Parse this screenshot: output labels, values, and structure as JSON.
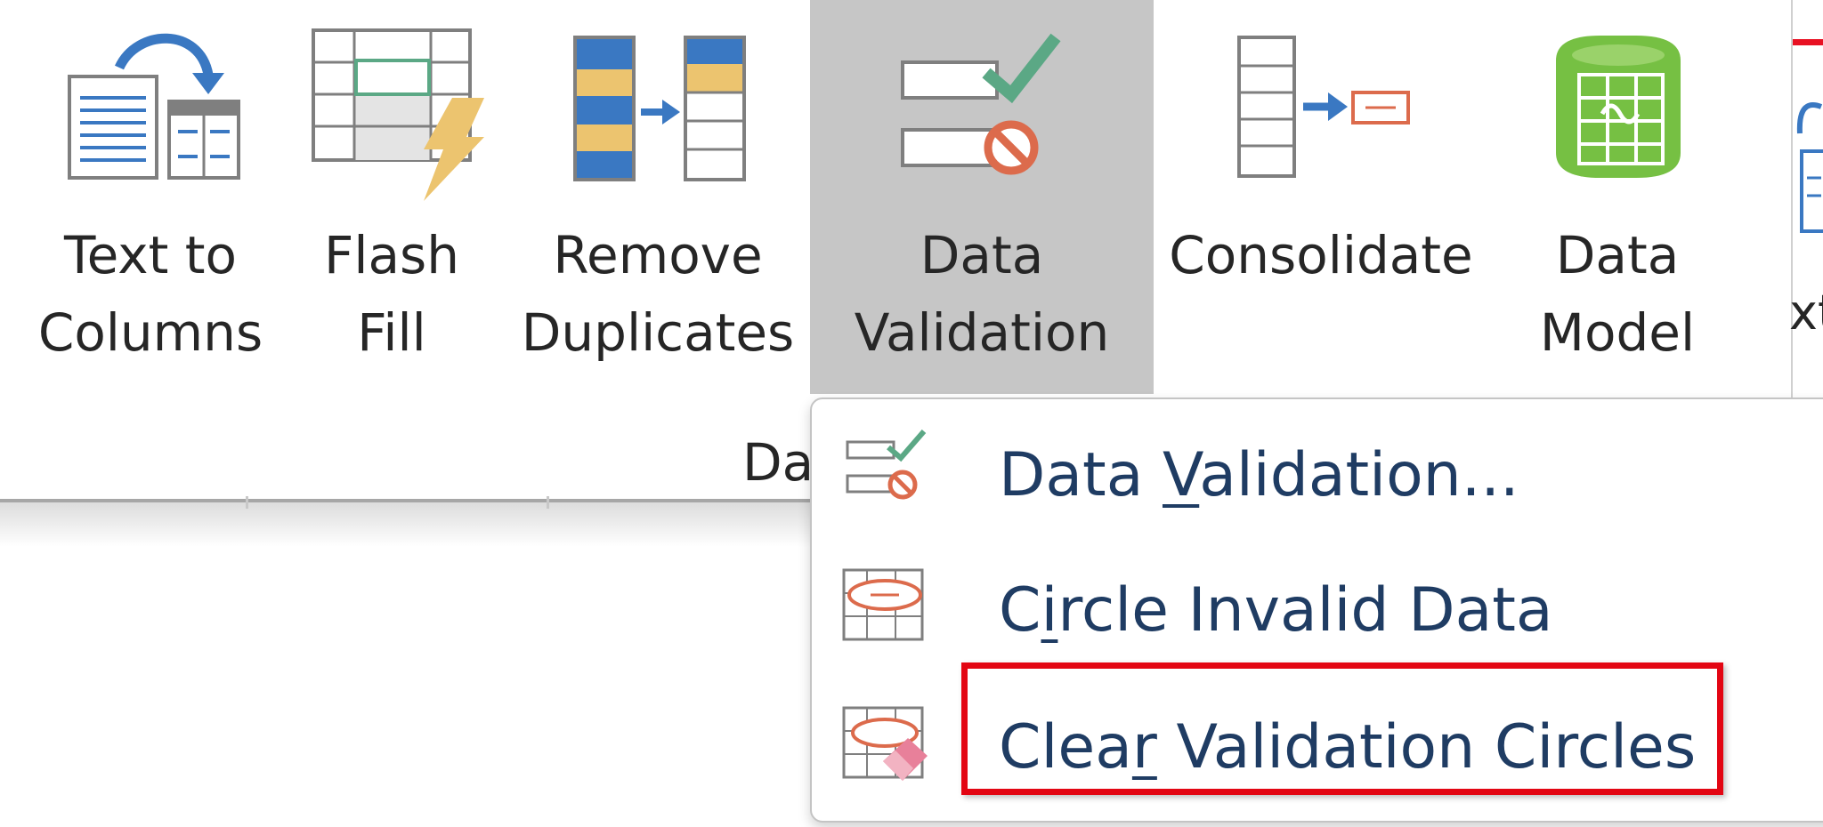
{
  "ribbon": {
    "buttons": [
      {
        "line1": "Text to",
        "line2": "Columns"
      },
      {
        "line1": "Flash",
        "line2": "Fill"
      },
      {
        "line1": "Remove",
        "line2": "Duplicates"
      },
      {
        "line1": "Data",
        "line2": "Validation",
        "has_dropdown": true,
        "active": true
      },
      {
        "line1": "Consolidate",
        "line2": ""
      },
      {
        "line1": "Data",
        "line2": "Model",
        "has_dropdown": true
      }
    ],
    "group_label_visible": "Da",
    "edge_text_visible": "xt"
  },
  "menu": {
    "items": [
      {
        "pre": "Data ",
        "key": "V",
        "post": "alidation..."
      },
      {
        "pre": "C",
        "key": "i",
        "post": "rcle Invalid Data"
      },
      {
        "pre": "Clea",
        "key": "r",
        "post": " Validation Circles",
        "highlighted": true
      }
    ]
  },
  "colors": {
    "active_button_bg": "#c6c6c6",
    "menu_text": "#1f3c63",
    "highlight_border": "#e30613",
    "icon_blue": "#3a78c2",
    "icon_gold": "#ecc46f",
    "icon_green": "#5ba885",
    "icon_red": "#dc6b4c",
    "icon_model_green": "#76c043"
  },
  "icons": [
    "text-to-columns-icon",
    "flash-fill-icon",
    "remove-duplicates-icon",
    "data-validation-icon",
    "consolidate-icon",
    "data-model-icon",
    "circle-invalid-icon",
    "clear-circles-icon"
  ]
}
